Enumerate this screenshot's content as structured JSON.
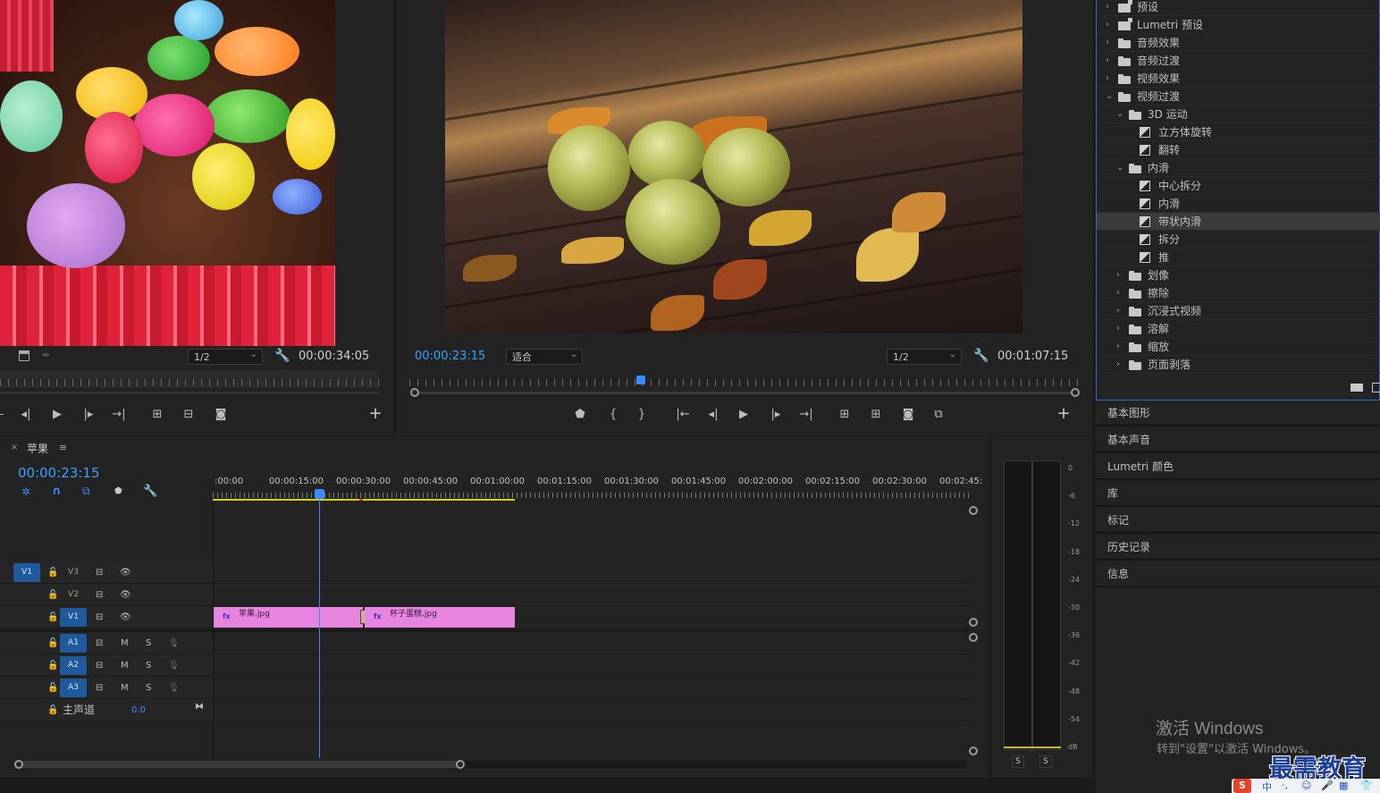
{
  "source_monitor": {
    "zoom": "1/2",
    "timecode": "00:00:34:05"
  },
  "program_monitor": {
    "timecode": "00:00:23:15",
    "fit": "适合",
    "zoom": "1/2",
    "duration": "00:01:07:15"
  },
  "effects": {
    "items": [
      {
        "label": "预设",
        "kind": "preset",
        "level": 0,
        "state": "collapsed"
      },
      {
        "label": "Lumetri 预设",
        "kind": "preset",
        "level": 0,
        "state": "collapsed"
      },
      {
        "label": "音频效果",
        "kind": "folder",
        "level": 0,
        "state": "collapsed"
      },
      {
        "label": "音频过渡",
        "kind": "folder",
        "level": 0,
        "state": "collapsed"
      },
      {
        "label": "视频效果",
        "kind": "folder",
        "level": 0,
        "state": "collapsed"
      },
      {
        "label": "视频过渡",
        "kind": "folder",
        "level": 0,
        "state": "expanded"
      },
      {
        "label": "3D 运动",
        "kind": "folder",
        "level": 1,
        "state": "expanded"
      },
      {
        "label": "立方体旋转",
        "kind": "effect",
        "level": 2
      },
      {
        "label": "翻转",
        "kind": "effect",
        "level": 2
      },
      {
        "label": "内滑",
        "kind": "folder",
        "level": 1,
        "state": "expanded"
      },
      {
        "label": "中心拆分",
        "kind": "effect",
        "level": 2
      },
      {
        "label": "内滑",
        "kind": "effect",
        "level": 2
      },
      {
        "label": "带状内滑",
        "kind": "effect",
        "level": 2,
        "selected": true
      },
      {
        "label": "拆分",
        "kind": "effect",
        "level": 2
      },
      {
        "label": "推",
        "kind": "effect",
        "level": 2
      },
      {
        "label": "划像",
        "kind": "folder",
        "level": 1,
        "state": "collapsed"
      },
      {
        "label": "擦除",
        "kind": "folder",
        "level": 1,
        "state": "collapsed"
      },
      {
        "label": "沉浸式视频",
        "kind": "folder",
        "level": 1,
        "state": "collapsed"
      },
      {
        "label": "溶解",
        "kind": "folder",
        "level": 1,
        "state": "collapsed"
      },
      {
        "label": "缩放",
        "kind": "folder",
        "level": 1,
        "state": "collapsed"
      },
      {
        "label": "页面剥落",
        "kind": "folder",
        "level": 1,
        "state": "collapsed"
      }
    ]
  },
  "side_panels": [
    "基本图形",
    "基本声音",
    "Lumetri 颜色",
    "库",
    "标记",
    "历史记录",
    "信息"
  ],
  "timeline": {
    "tab_close": "×",
    "sequence_name": "苹果",
    "menu_glyph": "≡",
    "timecode": "00:00:23:15",
    "ruler_labels": [
      ":00:00",
      "00:00:15:00",
      "00:00:30:00",
      "00:00:45:00",
      "00:01:00:00",
      "00:01:15:00",
      "00:01:30:00",
      "00:01:45:00",
      "00:02:00:00",
      "00:02:15:00",
      "00:02:30:00",
      "00:02:45:"
    ],
    "tracks": {
      "v3": {
        "src": "V1",
        "name": "V3"
      },
      "v2": {
        "name": "V2"
      },
      "v1": {
        "name": "V1"
      },
      "a1": {
        "name": "A1",
        "m": "M",
        "s": "S"
      },
      "a2": {
        "name": "A2",
        "m": "M",
        "s": "S"
      },
      "a3": {
        "name": "A3",
        "m": "M",
        "s": "S"
      }
    },
    "master": {
      "label": "主声道",
      "value": "0.0"
    },
    "clips": [
      {
        "name": "苹果.jpg",
        "fx": "fx"
      },
      {
        "name": "杯子蛋糕.jpg",
        "fx": "fx"
      }
    ]
  },
  "audio_meter": {
    "scale": [
      "0",
      "-6",
      "-12",
      "-18",
      "-24",
      "-30",
      "-36",
      "-42",
      "-48",
      "-54",
      "dB"
    ],
    "solo": [
      "S",
      "S"
    ]
  },
  "watermark": {
    "line1": "激活 Windows",
    "line2": "转到\"设置\"以激活 Windows。",
    "brand": "最需教育"
  },
  "ime": {
    "lang": "中"
  }
}
